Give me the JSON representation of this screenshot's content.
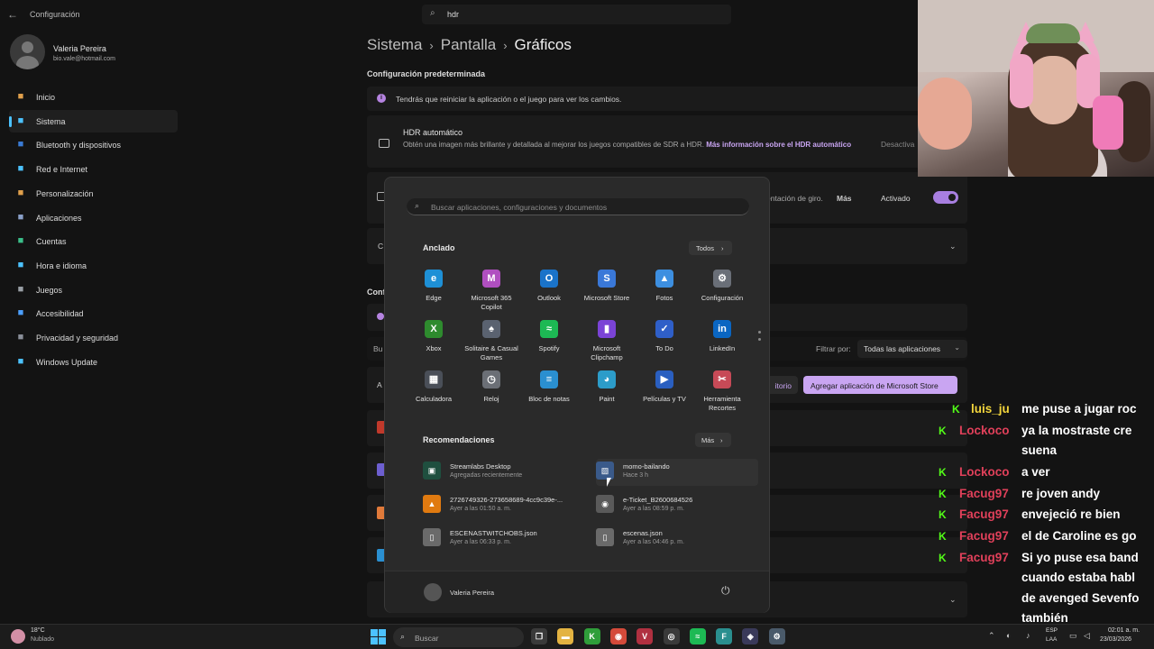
{
  "settings": {
    "window_title": "Configuración",
    "search_value": "hdr",
    "user": {
      "name": "Valeria Pereira",
      "email": "bio.vale@hotmail.com"
    },
    "nav": [
      {
        "label": "Inicio",
        "icon": "home-icon",
        "color": "#e0a04c"
      },
      {
        "label": "Sistema",
        "icon": "system-icon",
        "color": "#4cc2ff"
      },
      {
        "label": "Bluetooth y dispositivos",
        "icon": "bluetooth-icon",
        "color": "#3a7bd5"
      },
      {
        "label": "Red e Internet",
        "icon": "network-icon",
        "color": "#4cc2ff"
      },
      {
        "label": "Personalización",
        "icon": "brush-icon",
        "color": "#e0a04c"
      },
      {
        "label": "Aplicaciones",
        "icon": "apps-icon",
        "color": "#8aa0c8"
      },
      {
        "label": "Cuentas",
        "icon": "accounts-icon",
        "color": "#3bbf8a"
      },
      {
        "label": "Hora e idioma",
        "icon": "clock-globe-icon",
        "color": "#4cc2ff"
      },
      {
        "label": "Juegos",
        "icon": "gamepad-icon",
        "color": "#9aa0a6"
      },
      {
        "label": "Accesibilidad",
        "icon": "accessibility-icon",
        "color": "#4c9fff"
      },
      {
        "label": "Privacidad y seguridad",
        "icon": "shield-icon",
        "color": "#8a8f99"
      },
      {
        "label": "Windows Update",
        "icon": "update-icon",
        "color": "#4cc2ff"
      }
    ],
    "breadcrumb": [
      "Sistema",
      "Pantalla",
      "Gráficos"
    ],
    "section_default": "Configuración predeterminada",
    "restart_notice": "Tendrás que reiniciar la aplicación o el juego para ver los cambios.",
    "auto_hdr": {
      "title": "HDR automático",
      "desc": "Obtén una imagen más brillante y detallada al mejorar los juegos compatibles de SDR a HDR.",
      "link": "Más información sobre el HDR automático",
      "state": "Desactiva"
    },
    "rotation": {
      "text": "entación de giro.",
      "more": "Más",
      "state": "Activado"
    },
    "filter_label": "Filtrar por:",
    "filter_value": "Todas las aplicaciones",
    "btn_browse": "itorio",
    "btn_add_store": "Agregar aplicación de Microsoft Store",
    "partial": {
      "c1": "C",
      "conf": "Conf",
      "bu": "Bu",
      "a": "A"
    }
  },
  "start_menu": {
    "search_placeholder": "Buscar aplicaciones, configuraciones y documentos",
    "pinned_title": "Anclado",
    "all_label": "Todos",
    "pinned": [
      {
        "label": "Edge",
        "icon": "edge-icon",
        "color": "#1e90d6",
        "glyph": "e"
      },
      {
        "label": "Microsoft 365 Copilot",
        "icon": "m365-copilot-icon",
        "color": "#b04fc0",
        "glyph": "M"
      },
      {
        "label": "Outlook",
        "icon": "outlook-icon",
        "color": "#1a73c9",
        "glyph": "O"
      },
      {
        "label": "Microsoft Store",
        "icon": "store-icon",
        "color": "#3a78d8",
        "glyph": "S"
      },
      {
        "label": "Fotos",
        "icon": "photos-icon",
        "color": "#3d8fe0",
        "glyph": "▲"
      },
      {
        "label": "Configuración",
        "icon": "settings-gear-icon",
        "color": "#6a6f78",
        "glyph": "⚙"
      },
      {
        "label": "Xbox",
        "icon": "xbox-icon",
        "color": "#2e8b2e",
        "glyph": "X"
      },
      {
        "label": "Solitaire & Casual Games",
        "icon": "solitaire-icon",
        "color": "#5a6270",
        "glyph": "♠"
      },
      {
        "label": "Spotify",
        "icon": "spotify-icon",
        "color": "#1db954",
        "glyph": "≈"
      },
      {
        "label": "Microsoft Clipchamp",
        "icon": "clipchamp-icon",
        "color": "#7b43d6",
        "glyph": "▮"
      },
      {
        "label": "To Do",
        "icon": "todo-icon",
        "color": "#2f5fc8",
        "glyph": "✓"
      },
      {
        "label": "LinkedIn",
        "icon": "linkedin-icon",
        "color": "#0a66c2",
        "glyph": "in"
      },
      {
        "label": "Calculadora",
        "icon": "calculator-icon",
        "color": "#4a4f58",
        "glyph": "▦"
      },
      {
        "label": "Reloj",
        "icon": "clock-icon",
        "color": "#6b6f76",
        "glyph": "◷"
      },
      {
        "label": "Bloc de notas",
        "icon": "notepad-icon",
        "color": "#2a8fd0",
        "glyph": "≡"
      },
      {
        "label": "Paint",
        "icon": "paint-icon",
        "color": "#2c9cc9",
        "glyph": "◕"
      },
      {
        "label": "Películas y TV",
        "icon": "movies-tv-icon",
        "color": "#2a5fc0",
        "glyph": "▶"
      },
      {
        "label": "Herramienta Recortes",
        "icon": "snipping-tool-icon",
        "color": "#c74a57",
        "glyph": "✂"
      }
    ],
    "recommended_title": "Recomendaciones",
    "more_label": "Más",
    "recommended": [
      {
        "name": "Streamlabs Desktop",
        "sub": "Agregadas recientemente",
        "icon": "streamlabs-icon",
        "color": "#1f4f3f",
        "glyph": "▣"
      },
      {
        "name": "momo-bailando",
        "sub": "Hace 3 h",
        "icon": "image-file-icon",
        "color": "#3a5a8a",
        "glyph": "▧"
      },
      {
        "name": "2726749326-273658689-4cc9c39e-...",
        "sub": "Ayer a las 01:50 a. m.",
        "icon": "vlc-icon",
        "color": "#e07a10",
        "glyph": "▲"
      },
      {
        "name": "e-Ticket_B2600684526",
        "sub": "Ayer a las 08:59 p. m.",
        "icon": "chrome-pdf-icon",
        "color": "#5a5a5a",
        "glyph": "◉"
      },
      {
        "name": "ESCENASTWITCHOBS.json",
        "sub": "Ayer a las 06:33 p. m.",
        "icon": "file-icon",
        "color": "#6a6a6a",
        "glyph": "▯"
      },
      {
        "name": "escenas.json",
        "sub": "Ayer a las 04:46 p. m.",
        "icon": "file-icon",
        "color": "#6a6a6a",
        "glyph": "▯"
      }
    ],
    "footer_user": "Valeria Pereira"
  },
  "chat": [
    {
      "user": "luis_ju",
      "user_color": "#f2d53c",
      "lines": [
        "me puse a jugar roc"
      ]
    },
    {
      "user": "Lockoco",
      "user_color": "#e0405a",
      "lines": [
        "ya la mostraste cre",
        "suena"
      ]
    },
    {
      "user": "Lockoco",
      "user_color": "#e0405a",
      "lines": [
        "a ver"
      ]
    },
    {
      "user": "Facug97",
      "user_color": "#e0405a",
      "lines": [
        "re joven andy"
      ]
    },
    {
      "user": "Facug97",
      "user_color": "#e0405a",
      "lines": [
        "envejeció re bien"
      ]
    },
    {
      "user": "Facug97",
      "user_color": "#e0405a",
      "lines": [
        "el de Caroline es go"
      ]
    },
    {
      "user": "Facug97",
      "user_color": "#e0405a",
      "lines": [
        "Si yo puse esa band",
        "cuando estaba habl",
        "de avenged Sevenfo",
        "también"
      ]
    }
  ],
  "chat_badge": "K",
  "taskbar": {
    "temp": "18°C",
    "condition": "Nublado",
    "search_label": "Buscar",
    "lang1": "ESP",
    "lang2": "LAA",
    "time": "02:01 a. m.",
    "date": "23/03/2026",
    "apps": [
      {
        "icon": "task-view-icon",
        "color": "#3a3a3a",
        "glyph": "❐"
      },
      {
        "icon": "file-explorer-icon",
        "color": "#e3b341",
        "glyph": "▬"
      },
      {
        "icon": "kick-icon",
        "color": "#2f9e3a",
        "glyph": "K"
      },
      {
        "icon": "chrome-icon",
        "color": "#d44a3a",
        "glyph": "◉"
      },
      {
        "icon": "vivaldi-icon",
        "color": "#b03040",
        "glyph": "V"
      },
      {
        "icon": "obs-icon",
        "color": "#3a3a3a",
        "glyph": "◎"
      },
      {
        "icon": "spotify-icon",
        "color": "#1db954",
        "glyph": "≈"
      },
      {
        "icon": "notes-icon",
        "color": "#2a8f8f",
        "glyph": "F"
      },
      {
        "icon": "streamlabs-icon",
        "color": "#3a3a5a",
        "glyph": "◈"
      },
      {
        "icon": "settings-gear-icon",
        "color": "#4a5a6a",
        "glyph": "⚙"
      }
    ]
  }
}
